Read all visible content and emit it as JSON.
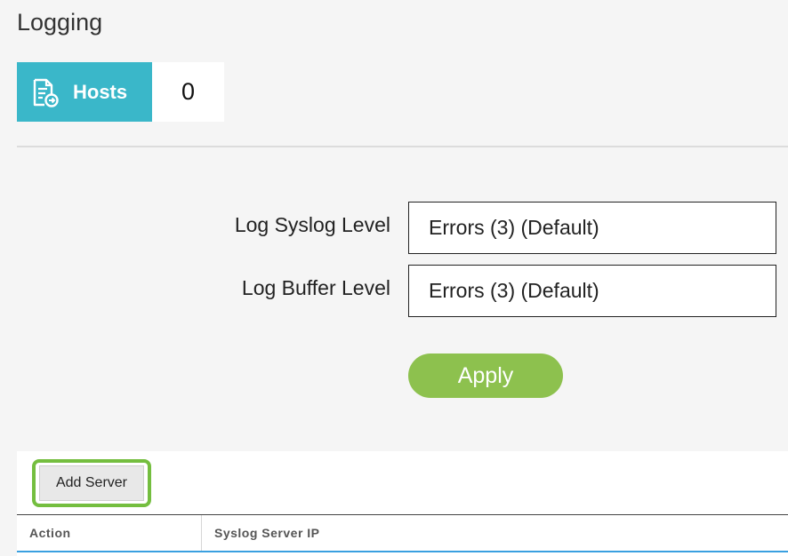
{
  "page": {
    "title": "Logging"
  },
  "hosts": {
    "icon": "server-add-icon",
    "label": "Hosts",
    "count": "0"
  },
  "form": {
    "syslog_label": "Log Syslog Level",
    "syslog_value": "Errors (3) (Default)",
    "buffer_label": "Log Buffer Level",
    "buffer_value": "Errors (3) (Default)",
    "apply_label": "Apply"
  },
  "servers": {
    "add_label": "Add Server",
    "columns": [
      "Action",
      "Syslog Server IP"
    ]
  },
  "colors": {
    "hosts_accent": "#3ab7c9",
    "apply_green": "#8dc14e",
    "highlight_green": "#74be3f",
    "table_underline": "#3aa0e0"
  }
}
